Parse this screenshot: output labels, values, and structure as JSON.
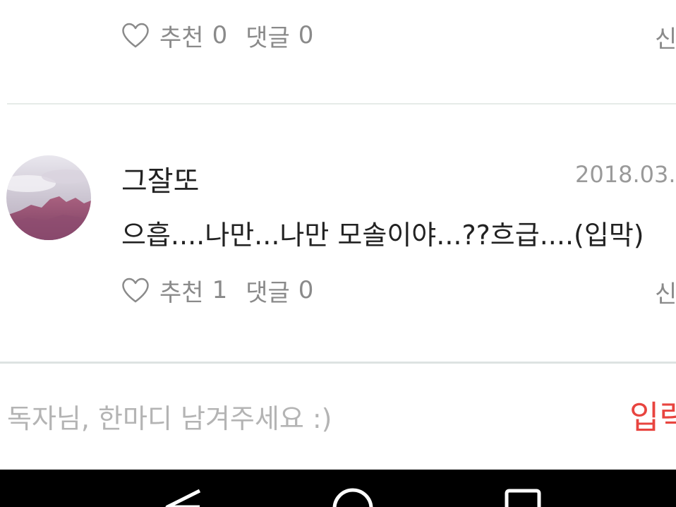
{
  "previous_comment": {
    "like_label": "추천",
    "like_count": "0",
    "comment_label": "댓글",
    "comment_count": "0",
    "report_label": "신"
  },
  "comment": {
    "username": "그잘또",
    "date": "2018.03.",
    "text": "으흡....나만...나만 모솔이야...??흐급....(입막)",
    "like_label": "추천",
    "like_count": "1",
    "comment_label": "댓글",
    "comment_count": "0",
    "report_label": "신"
  },
  "input": {
    "placeholder": "독자님, 한마디 남겨주세요 :)",
    "submit_label": "입력"
  },
  "colors": {
    "submit": "#e8443f",
    "meta_text": "#8a8a8a",
    "divider": "#e6ebe8",
    "nav_bar": "#000000"
  },
  "icons": {
    "like": "heart-outline-icon",
    "nav_back": "back-triangle-icon",
    "nav_home": "home-circle-icon",
    "nav_recents": "recents-square-icon"
  }
}
